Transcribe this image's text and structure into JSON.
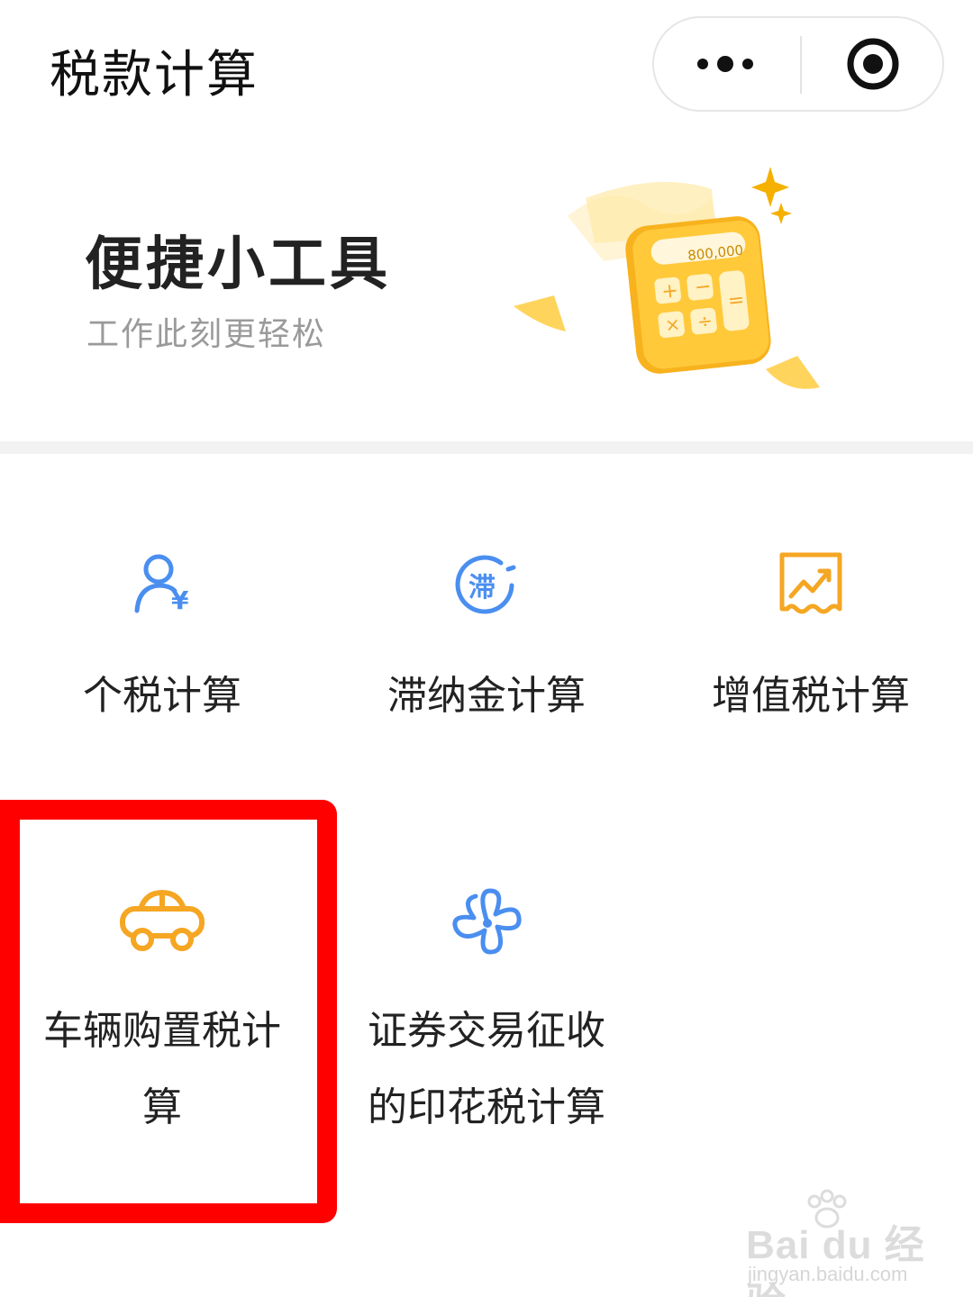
{
  "header": {
    "title": "税款计算"
  },
  "banner": {
    "title": "便捷小工具",
    "subtitle": "工作此刻更轻松",
    "calculator_display": "800,000"
  },
  "tools": [
    {
      "label": "个税计算",
      "icon": "person-yen-icon"
    },
    {
      "label": "滞纳金计算",
      "icon": "late-fee-icon"
    },
    {
      "label": "增值税计算",
      "icon": "trend-chart-icon"
    },
    {
      "label_line1": "车辆购置税计",
      "label_line2": "算",
      "icon": "car-icon"
    },
    {
      "label_line1": "证券交易征收",
      "label_line2": "的印花税计算",
      "icon": "clover-icon"
    }
  ],
  "late_fee_glyph": "滞",
  "watermark": {
    "logo": "Bai du 经验",
    "url": "jingyan.baidu.com"
  },
  "colors": {
    "blue": "#4a8ef0",
    "orange": "#f5a623",
    "highlight": "#ff0000"
  }
}
